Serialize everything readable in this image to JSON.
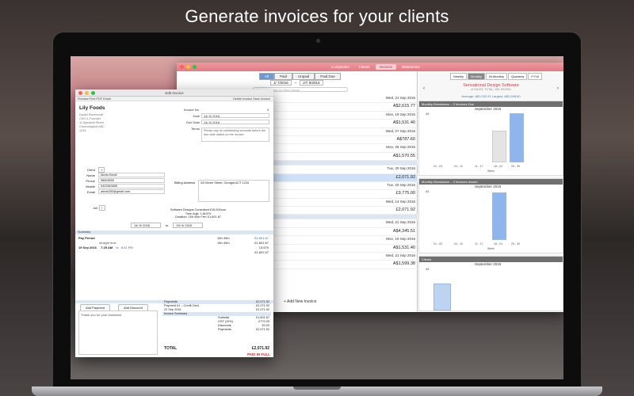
{
  "banner": "Generate invoices for your clients",
  "back_window": {
    "tabs": [
      "Companies",
      "Clients",
      "Invoices",
      "Statements"
    ],
    "active_tab": "Invoices",
    "filter": [
      "All",
      "Paid",
      "Unpaid",
      "Paid Due"
    ],
    "date_from": "1/ 7/2016",
    "date_to": "27/ 9/2016",
    "search_placeholder": "Search Invoice or Client Name",
    "rows": [
      {
        "date": "Wed, 21 Sep 2016",
        "amount": ""
      },
      {
        "date": "",
        "amount": "A$2,615.77"
      },
      {
        "date": "Mon, 19 Sep 2016",
        "amount": ""
      },
      {
        "date": "",
        "amount": "A$1,531.40"
      },
      {
        "date": "Wed, 07 Sep 2016",
        "amount": ""
      },
      {
        "date": "",
        "amount": "A$787.60"
      },
      {
        "date": "Mon, 26 Sep 2016",
        "amount": ""
      },
      {
        "date": "",
        "amount": "A$1,570.55"
      },
      {
        "date": "Tue, 20 Sep 2016",
        "amount": ""
      },
      {
        "date": "",
        "amount": "£2,071.92"
      },
      {
        "date": "Tue, 20 Sep 2016",
        "amount": ""
      },
      {
        "date": "",
        "amount": "£9,775.00"
      },
      {
        "date": "Wed, 14 Sep 2016",
        "amount": ""
      },
      {
        "date": "",
        "amount": "£2,071.92"
      },
      {
        "date": "Wed, 21 Sep 2016",
        "amount": ""
      },
      {
        "date": "",
        "amount": "A$4,345.51"
      },
      {
        "date": "Mon, 19 Sep 2016",
        "amount": ""
      },
      {
        "date": "",
        "amount": "A$1,531.40"
      },
      {
        "date": "Wed, 21 Sep 2016",
        "amount": ""
      },
      {
        "date": "",
        "amount": "A$1,599.38"
      }
    ],
    "add_invoice": "Add New Invoice"
  },
  "right_panel": {
    "periods": [
      "Weekly",
      "Monthly",
      "Bi-Monthly",
      "Quarterly",
      "FY16"
    ],
    "active_period": "Monthly",
    "company_name": "Sensational Design Software",
    "company_sub": "of SALES, TOTAL, GEL PAYING",
    "average": "Average: A$1,032.91",
    "largest": "Largest: A$2,898.60",
    "panels": [
      {
        "title": "Monthly Breakdown – 2 Invoices Due",
        "month": "September 2016",
        "y_label": "A$",
        "axis": "Week",
        "ticks": [
          "01 - 03",
          "04 - 10",
          "11 - 17",
          "18 - 24",
          "25 - 30"
        ]
      },
      {
        "title": "Monthly Breakdown – 3 Invoices Issued",
        "month": "September 2016",
        "y_label": "A$",
        "axis": "Week",
        "ticks": [
          "01 - 03",
          "04 - 10",
          "11 - 17",
          "18 - 24",
          "25 - 30"
        ]
      },
      {
        "title": "Clients",
        "month": "September 2016",
        "y_label": "A$",
        "axis": "",
        "ticks": []
      }
    ]
  },
  "edit_window": {
    "title": "Edit Invoice",
    "toolbar_left": "Preview  Print  PDF  Email",
    "toolbar_delete": "Delete Invoice",
    "toolbar_save": "Save Invoice",
    "client_name": "Lily Foods",
    "client_addr": [
      "Daniel Ravencroft",
      "CEO & Founder",
      "",
      "11 Alphabet Street",
      "Chronological ABC",
      "1234"
    ],
    "invoice_no_label": "Invoice No.",
    "invoice_no": "3",
    "date_label": "Date",
    "date": "14/ 9/ 2016",
    "due_label": "Due Date",
    "due": "14/ 9/ 2016",
    "terms_label": "Terms",
    "terms": "Please pay all outstanding amounts before the due date stated on the invoice.",
    "client_label": "Client",
    "name_label": "Name",
    "name": "Alexis Beckl",
    "phone_label": "Phone",
    "phone": "98563555",
    "mobile_label": "Mobile",
    "mobile": "0402563555",
    "email_label": "Email",
    "email": "alexis253@gmail.com",
    "billing_label": "Billing Address",
    "billing": "43 Driven Street, Georgia ACT 1234",
    "job_label": "Job",
    "rate_line": "Software Designs Consultant £15.00/hour",
    "time_adj": "Time Adjs: 1.8197h",
    "duration": "Duration: 15h 40m   Fee: £1,601.67",
    "range_from": "14/ 9/ 2016",
    "range_to": "20/ 9/ 2016",
    "to_label": "to",
    "summary_label": "Summary",
    "pay_period": "Pay Period",
    "pay_hours": "15h 40m",
    "pay_amount": "£1,601.67",
    "straight_time": "straight time",
    "straight_hours": "15h 40m",
    "straight_amount": "£1,601.67",
    "entry_date": "19 Sep 2016",
    "entry_time": "7:25 AM",
    "entry_to": "to",
    "entry_end": "8:41 PM",
    "entry_hours": "13.67h",
    "entry_amount": "£1,601.67",
    "add_payment": "Add Payment",
    "add_discount": "Add Discount",
    "notes": "Thank you for your business!",
    "payments_label": "Payments",
    "payments_total": "£2,071.92",
    "payment_line": "Payment #1 – Credit Card",
    "payment_line_amt": "£2,071.92",
    "payment_date": "22 Sep 2016",
    "payment_date_amt": "£2,071.92",
    "inv_summary": "Invoice Summary",
    "subtotal_label": "Subtotal",
    "subtotal": "£1,601.67",
    "gst_label": "GST (10%)",
    "gst": "£770.25",
    "discounts_label": "Discounts",
    "discounts": "£0.00",
    "payments2_label": "Payments",
    "payments2": "£2,071.92",
    "total_label": "TOTAL",
    "total": "£2,071.92",
    "paid": "PAID IN FULL"
  }
}
